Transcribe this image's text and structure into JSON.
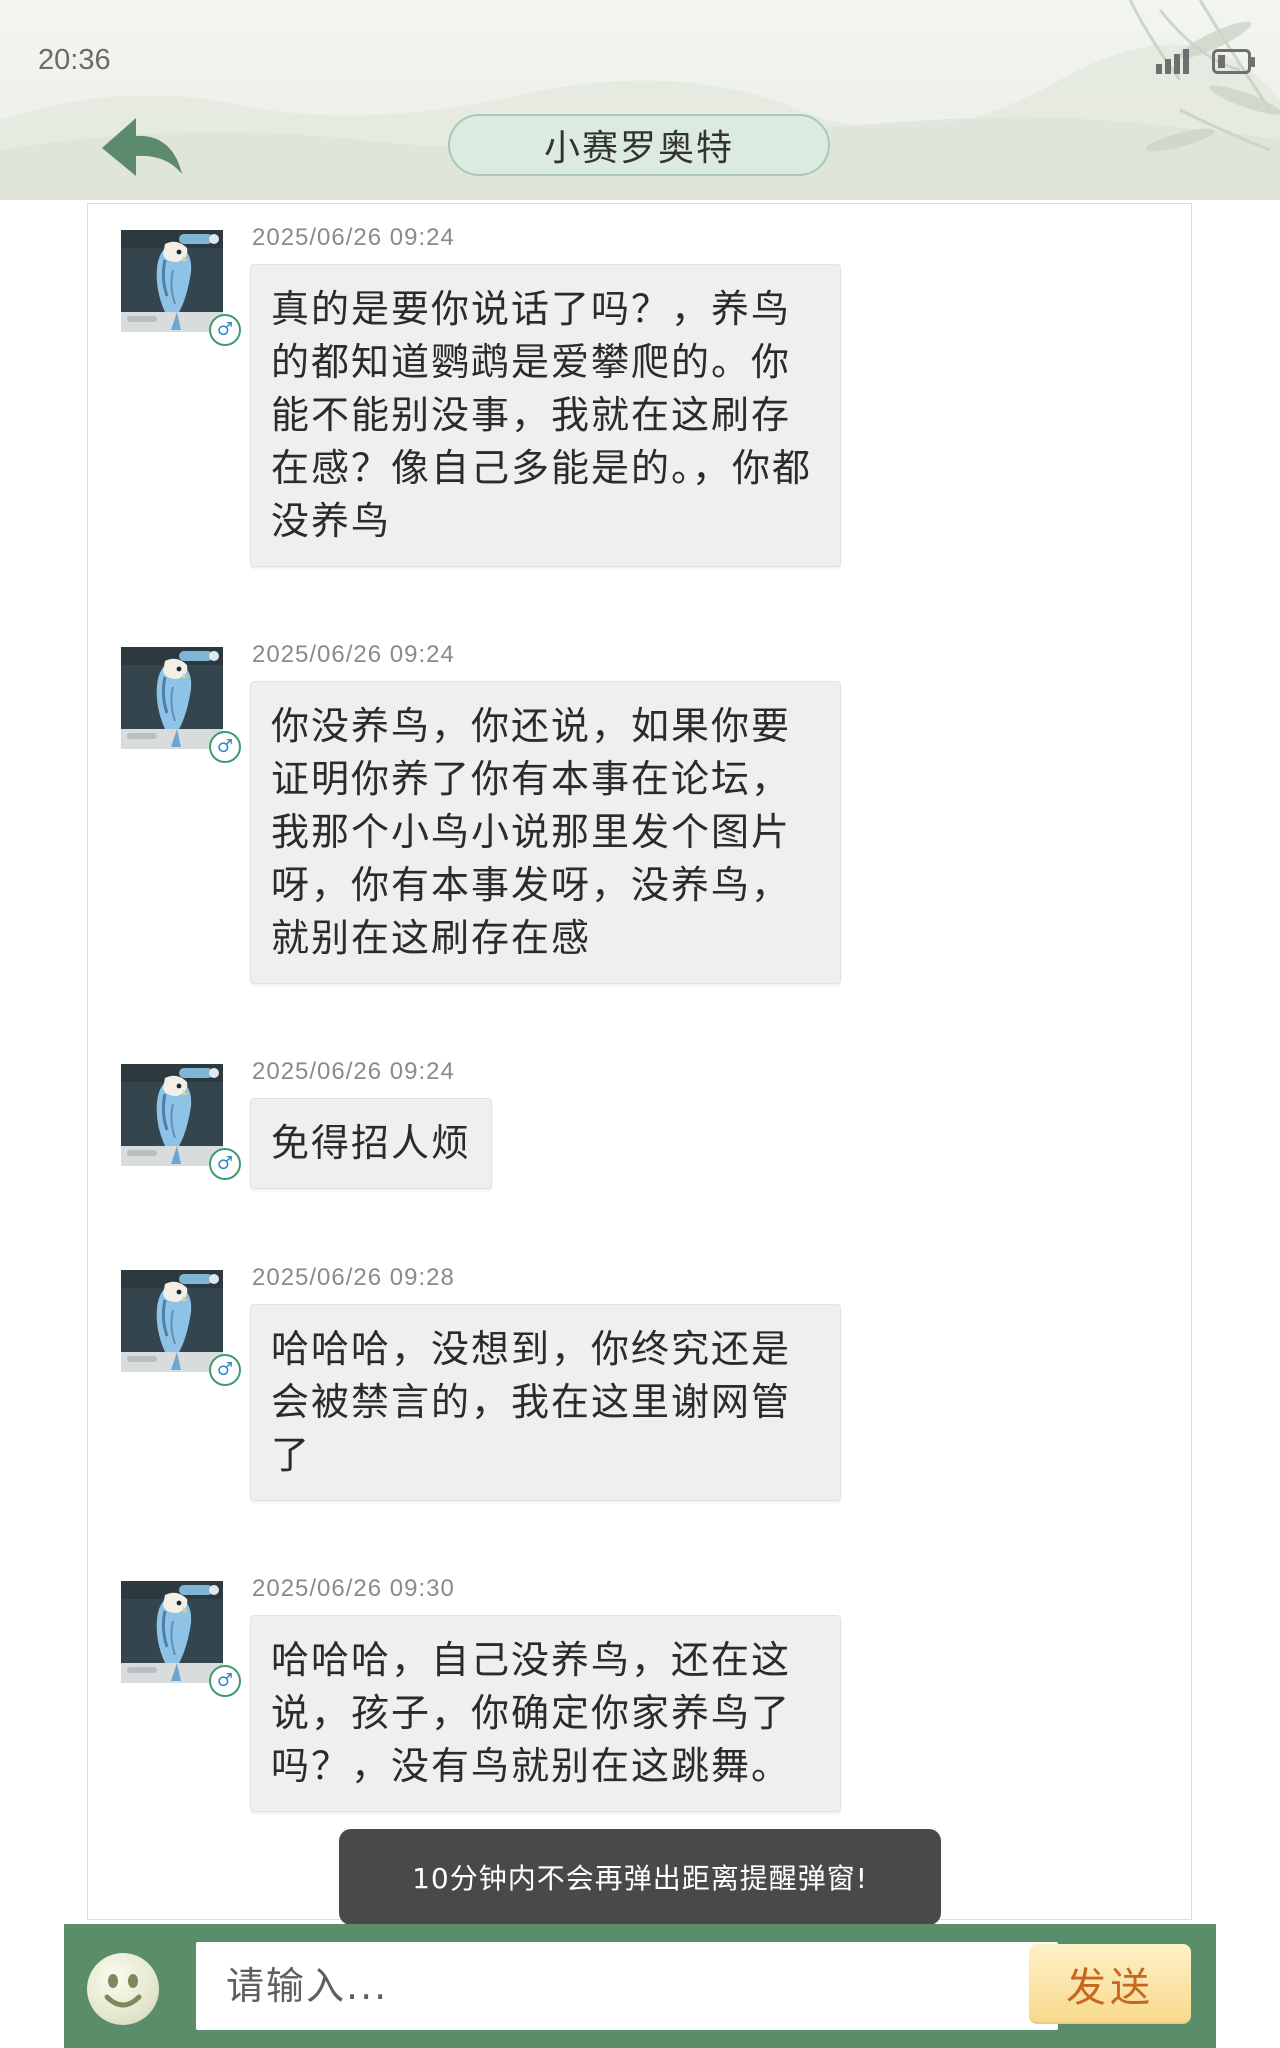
{
  "status_bar": {
    "time": "20:36",
    "icons": [
      "signal-icon",
      "battery-icon"
    ]
  },
  "header": {
    "title": "小赛罗奥特",
    "back_icon": "back-arrow-icon"
  },
  "messages": [
    {
      "timestamp": "2025/06/26 09:24",
      "text": "真的是要你说话了吗？，养鸟的都知道鹦鹉是爱攀爬的。你能不能别没事，我就在这刷存在感？像自己多能是的。，你都没养鸟",
      "gender": "♂"
    },
    {
      "timestamp": "2025/06/26 09:24",
      "text": "你没养鸟，你还说，如果你要证明你养了你有本事在论坛，我那个小鸟小说那里发个图片呀，你有本事发呀，没养鸟，就别在这刷存在感",
      "gender": "♂"
    },
    {
      "timestamp": "2025/06/26 09:24",
      "text": "免得招人烦",
      "gender": "♂"
    },
    {
      "timestamp": "2025/06/26 09:28",
      "text": "哈哈哈，没想到，你终究还是会被禁言的，我在这里谢网管了",
      "gender": "♂"
    },
    {
      "timestamp": "2025/06/26 09:30",
      "text": "哈哈哈，自己没养鸟，还在这说，孩子，你确定你家养鸟了吗？，没有鸟就别在这跳舞。",
      "gender": "♂"
    }
  ],
  "toast": "10分钟内不会再弹出距离提醒弹窗!",
  "input_bar": {
    "placeholder": "请输入...",
    "send_label": "发送",
    "emoji_icon": "smiley-icon"
  },
  "colors": {
    "bar_green": "#5a8d6a",
    "pill_bg": "#dcebe0",
    "bubble_bg": "#efefef",
    "send_text": "#c9661f"
  }
}
